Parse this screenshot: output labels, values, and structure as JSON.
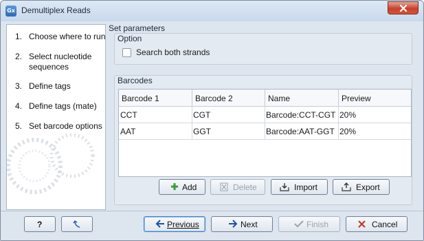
{
  "window": {
    "title": "Demultiplex Reads",
    "app_icon_text": "Gx",
    "close_icon": "close-icon"
  },
  "steps": [
    {
      "num": "1.",
      "label": "Choose where to run"
    },
    {
      "num": "2.",
      "label": "Select nucleotide sequences"
    },
    {
      "num": "3.",
      "label": "Define tags"
    },
    {
      "num": "4.",
      "label": "Define tags (mate)"
    },
    {
      "num": "5.",
      "label": "Set barcode options"
    }
  ],
  "panel": {
    "title": "Set parameters",
    "option_group": {
      "title": "Option",
      "search_both_strands": {
        "label": "Search both strands",
        "checked": false
      }
    },
    "barcodes_group": {
      "title": "Barcodes",
      "columns": [
        "Barcode 1",
        "Barcode 2",
        "Name",
        "Preview"
      ],
      "rows": [
        [
          "CCT",
          "CGT",
          "Barcode:CCT-CGT",
          "20%"
        ],
        [
          "AAT",
          "GGT",
          "Barcode:AAT-GGT",
          "20%"
        ]
      ],
      "buttons": {
        "add": "Add",
        "delete": "Delete",
        "import": "Import",
        "export": "Export"
      }
    }
  },
  "footer": {
    "help": "?",
    "previous": "Previous",
    "next": "Next",
    "finish": "Finish",
    "cancel": "Cancel"
  },
  "colors": {
    "background": "#dde5ef",
    "close_button": "#c8412a",
    "arrow_blue": "#1f4fa3",
    "cancel_red": "#c0392b",
    "add_green": "#3a9a3a"
  }
}
